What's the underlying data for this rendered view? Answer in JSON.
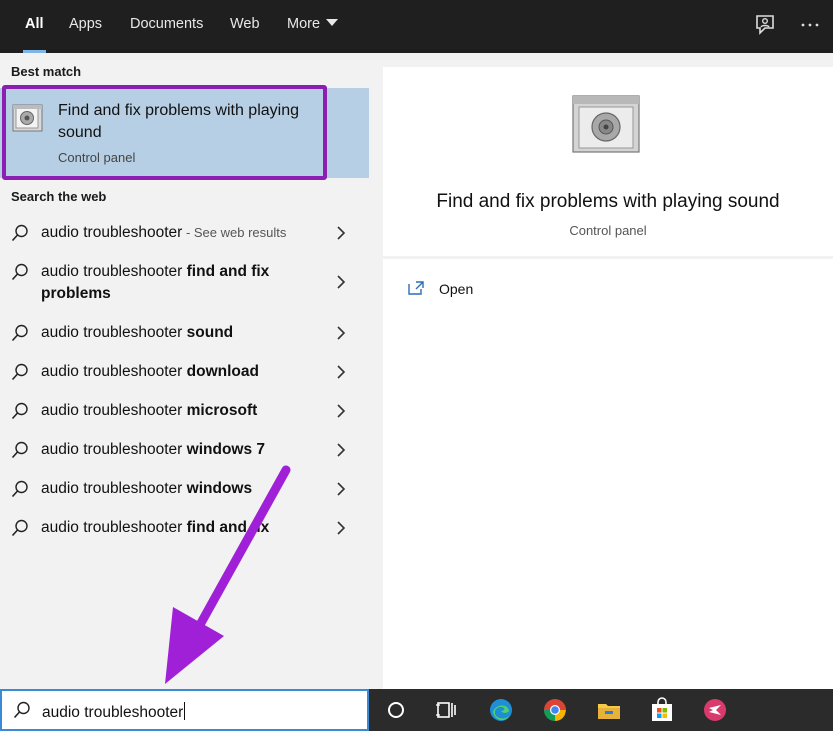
{
  "tabs": [
    {
      "label": "All"
    },
    {
      "label": "Apps"
    },
    {
      "label": "Documents"
    },
    {
      "label": "Web"
    },
    {
      "label": "More"
    }
  ],
  "best_match": {
    "section_title": "Best match",
    "title": "Find and fix problems with playing sound",
    "subtitle": "Control panel"
  },
  "web": {
    "section_title": "Search the web",
    "results": [
      {
        "prefix": "audio troubleshooter",
        "bold": "",
        "hint": " - See web results"
      },
      {
        "prefix": "audio troubleshooter ",
        "bold": "find and fix problems",
        "hint": ""
      },
      {
        "prefix": "audio troubleshooter ",
        "bold": "sound",
        "hint": ""
      },
      {
        "prefix": "audio troubleshooter ",
        "bold": "download",
        "hint": ""
      },
      {
        "prefix": "audio troubleshooter ",
        "bold": "microsoft",
        "hint": ""
      },
      {
        "prefix": "audio troubleshooter ",
        "bold": "windows 7",
        "hint": ""
      },
      {
        "prefix": "audio troubleshooter ",
        "bold": "windows",
        "hint": ""
      },
      {
        "prefix": "audio troubleshooter ",
        "bold": "find and fix",
        "hint": ""
      }
    ]
  },
  "preview": {
    "title": "Find and fix problems with playing sound",
    "subtitle": "Control panel",
    "open_label": "Open"
  },
  "search": {
    "value": "audio troubleshooter"
  },
  "icons": {
    "feedback": "feedback-icon",
    "more_options": "more-options-icon",
    "cortana": "cortana-circle-icon",
    "task_view": "task-view-icon",
    "edge": "edge-icon",
    "chrome": "chrome-icon",
    "explorer": "file-explorer-icon",
    "store": "store-icon",
    "app": "app-icon"
  },
  "colors": {
    "highlight_border": "#8b1fb4",
    "selection_bg": "#b7cfe4",
    "arrow": "#a020d8"
  }
}
